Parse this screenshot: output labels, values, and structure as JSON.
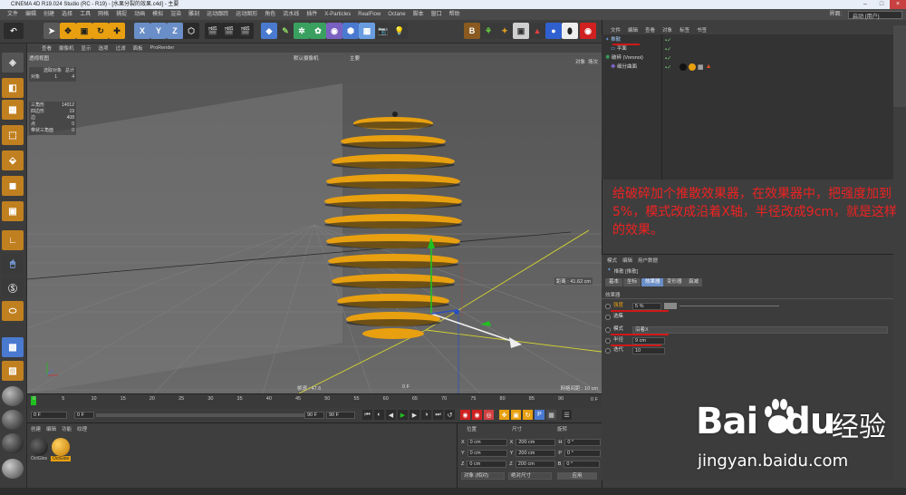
{
  "window": {
    "title": "CINEMA 4D R19.024 Studio (RC - R19) - [水果分裂的效果.c4d] - 主要"
  },
  "menu": {
    "items": [
      "文件",
      "编辑",
      "创建",
      "选择",
      "工具",
      "网格",
      "捕捉",
      "动画",
      "模拟",
      "渲染",
      "雕刻",
      "运动跟踪",
      "运动图形",
      "角色",
      "流水线",
      "插件",
      "X-Particles",
      "RealFlow",
      "Octane",
      "脚本",
      "窗口",
      "帮助"
    ],
    "layout_label": "界面:",
    "layout_value": "启动 (用户)"
  },
  "viewport": {
    "menu": [
      "查看",
      "摄像机",
      "显示",
      "选项",
      "过滤",
      "面板",
      "ProRender"
    ],
    "name": "透视视图",
    "camera": "默认摄像机",
    "overlay_label": "主要",
    "right_tabs": [
      "对象",
      "场次"
    ],
    "stats": {
      "header_sel": "选取对象",
      "header_total": "总计",
      "row_objects_label": "对象",
      "row_objects_sel": "1",
      "row_objects_total": "4",
      "triangles_label": "三角形",
      "triangles": "14012",
      "quads_label": "四边形",
      "quads": "19",
      "edges_label": "边",
      "edges": "408",
      "points_label": "点",
      "points": "0",
      "tiny_label": "带状三角面",
      "tiny": "0"
    },
    "distance_label": "距离 : 41.62 cm",
    "speed_label": "帧速 : 47.6",
    "frame_label": "0 F",
    "grid_label": "网格间距 : 10 cm"
  },
  "objects": {
    "tabs": [
      "文件",
      "编辑",
      "查看",
      "对象",
      "标签",
      "书签"
    ],
    "items": [
      {
        "name": "推散",
        "color": "#6a9de0"
      },
      {
        "name": "平面",
        "color": "#d0d0d0"
      },
      {
        "name": "破碎 (Voronoi)",
        "color": "#d0d0d0"
      },
      {
        "name": "细分曲面",
        "color": "#d0d0d0"
      }
    ]
  },
  "annotation": "给破碎加个推散效果器，在效果器中，把强度加到5%，模式改成沿着X轴，半径改成9cm，就是这样的效果。",
  "attributes": {
    "header_tabs": [
      "模式",
      "编辑",
      "用户数据"
    ],
    "object_title": "推散 [推散]",
    "tabs": [
      "基本",
      "坐标",
      "效果器",
      "变形器",
      "衰减"
    ],
    "active_tab": 2,
    "section": "效果器",
    "strength_label": "强度",
    "strength_value": "5 %",
    "selection_label": "选集",
    "mode_label": "模式",
    "mode_value": "沿着X",
    "radius_label": "半径",
    "radius_value": "9 cm",
    "iterations_label": "迭代",
    "iterations_value": "10"
  },
  "timeline": {
    "ticks": [
      "0",
      "5",
      "10",
      "15",
      "20",
      "25",
      "30",
      "35",
      "40",
      "45",
      "50",
      "55",
      "60",
      "65",
      "70",
      "75",
      "80",
      "85",
      "90"
    ],
    "end_label": "0 F",
    "start_field": "0 F",
    "current_field": "0 F",
    "end_field": "90 F",
    "max_field": "90 F"
  },
  "materials": {
    "menu": [
      "创建",
      "编辑",
      "功能",
      "纹理"
    ],
    "items": [
      {
        "name": "OctGlos",
        "color": "#222222",
        "selected": false
      },
      {
        "name": "OctGlos",
        "color": "#e8a010",
        "selected": true
      }
    ]
  },
  "coords": {
    "headers": [
      "位置",
      "尺寸",
      "旋转"
    ],
    "rows": [
      {
        "axis": "X",
        "pos": "0 cm",
        "size": "200 cm",
        "rot_label": "H",
        "rot": "0 °"
      },
      {
        "axis": "Y",
        "pos": "0 cm",
        "size": "200 cm",
        "rot_label": "P",
        "rot": "0 °"
      },
      {
        "axis": "Z",
        "pos": "0 cm",
        "size": "200 cm",
        "rot_label": "B",
        "rot": "0 °"
      }
    ],
    "mode_left": "对象 (相对)",
    "mode_mid": "绝对尺寸",
    "apply": "应用"
  },
  "watermark": {
    "brand": "Bai",
    "brand2": "du",
    "cn": "经验",
    "url": "jingyan.baidu.com"
  },
  "colors": {
    "accent": "#e8a010",
    "annotation": "#ee2222",
    "underline": "#d01818"
  }
}
